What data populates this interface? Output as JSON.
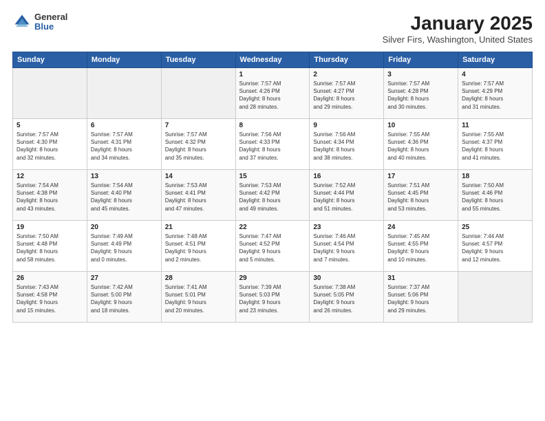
{
  "header": {
    "logo_general": "General",
    "logo_blue": "Blue",
    "title": "January 2025",
    "subtitle": "Silver Firs, Washington, United States"
  },
  "days_of_week": [
    "Sunday",
    "Monday",
    "Tuesday",
    "Wednesday",
    "Thursday",
    "Friday",
    "Saturday"
  ],
  "weeks": [
    [
      {
        "day": "",
        "info": ""
      },
      {
        "day": "",
        "info": ""
      },
      {
        "day": "",
        "info": ""
      },
      {
        "day": "1",
        "info": "Sunrise: 7:57 AM\nSunset: 4:26 PM\nDaylight: 8 hours\nand 28 minutes."
      },
      {
        "day": "2",
        "info": "Sunrise: 7:57 AM\nSunset: 4:27 PM\nDaylight: 8 hours\nand 29 minutes."
      },
      {
        "day": "3",
        "info": "Sunrise: 7:57 AM\nSunset: 4:28 PM\nDaylight: 8 hours\nand 30 minutes."
      },
      {
        "day": "4",
        "info": "Sunrise: 7:57 AM\nSunset: 4:29 PM\nDaylight: 8 hours\nand 31 minutes."
      }
    ],
    [
      {
        "day": "5",
        "info": "Sunrise: 7:57 AM\nSunset: 4:30 PM\nDaylight: 8 hours\nand 32 minutes."
      },
      {
        "day": "6",
        "info": "Sunrise: 7:57 AM\nSunset: 4:31 PM\nDaylight: 8 hours\nand 34 minutes."
      },
      {
        "day": "7",
        "info": "Sunrise: 7:57 AM\nSunset: 4:32 PM\nDaylight: 8 hours\nand 35 minutes."
      },
      {
        "day": "8",
        "info": "Sunrise: 7:56 AM\nSunset: 4:33 PM\nDaylight: 8 hours\nand 37 minutes."
      },
      {
        "day": "9",
        "info": "Sunrise: 7:56 AM\nSunset: 4:34 PM\nDaylight: 8 hours\nand 38 minutes."
      },
      {
        "day": "10",
        "info": "Sunrise: 7:55 AM\nSunset: 4:36 PM\nDaylight: 8 hours\nand 40 minutes."
      },
      {
        "day": "11",
        "info": "Sunrise: 7:55 AM\nSunset: 4:37 PM\nDaylight: 8 hours\nand 41 minutes."
      }
    ],
    [
      {
        "day": "12",
        "info": "Sunrise: 7:54 AM\nSunset: 4:38 PM\nDaylight: 8 hours\nand 43 minutes."
      },
      {
        "day": "13",
        "info": "Sunrise: 7:54 AM\nSunset: 4:40 PM\nDaylight: 8 hours\nand 45 minutes."
      },
      {
        "day": "14",
        "info": "Sunrise: 7:53 AM\nSunset: 4:41 PM\nDaylight: 8 hours\nand 47 minutes."
      },
      {
        "day": "15",
        "info": "Sunrise: 7:53 AM\nSunset: 4:42 PM\nDaylight: 8 hours\nand 49 minutes."
      },
      {
        "day": "16",
        "info": "Sunrise: 7:52 AM\nSunset: 4:44 PM\nDaylight: 8 hours\nand 51 minutes."
      },
      {
        "day": "17",
        "info": "Sunrise: 7:51 AM\nSunset: 4:45 PM\nDaylight: 8 hours\nand 53 minutes."
      },
      {
        "day": "18",
        "info": "Sunrise: 7:50 AM\nSunset: 4:46 PM\nDaylight: 8 hours\nand 55 minutes."
      }
    ],
    [
      {
        "day": "19",
        "info": "Sunrise: 7:50 AM\nSunset: 4:48 PM\nDaylight: 8 hours\nand 58 minutes."
      },
      {
        "day": "20",
        "info": "Sunrise: 7:49 AM\nSunset: 4:49 PM\nDaylight: 9 hours\nand 0 minutes."
      },
      {
        "day": "21",
        "info": "Sunrise: 7:48 AM\nSunset: 4:51 PM\nDaylight: 9 hours\nand 2 minutes."
      },
      {
        "day": "22",
        "info": "Sunrise: 7:47 AM\nSunset: 4:52 PM\nDaylight: 9 hours\nand 5 minutes."
      },
      {
        "day": "23",
        "info": "Sunrise: 7:46 AM\nSunset: 4:54 PM\nDaylight: 9 hours\nand 7 minutes."
      },
      {
        "day": "24",
        "info": "Sunrise: 7:45 AM\nSunset: 4:55 PM\nDaylight: 9 hours\nand 10 minutes."
      },
      {
        "day": "25",
        "info": "Sunrise: 7:44 AM\nSunset: 4:57 PM\nDaylight: 9 hours\nand 12 minutes."
      }
    ],
    [
      {
        "day": "26",
        "info": "Sunrise: 7:43 AM\nSunset: 4:58 PM\nDaylight: 9 hours\nand 15 minutes."
      },
      {
        "day": "27",
        "info": "Sunrise: 7:42 AM\nSunset: 5:00 PM\nDaylight: 9 hours\nand 18 minutes."
      },
      {
        "day": "28",
        "info": "Sunrise: 7:41 AM\nSunset: 5:01 PM\nDaylight: 9 hours\nand 20 minutes."
      },
      {
        "day": "29",
        "info": "Sunrise: 7:39 AM\nSunset: 5:03 PM\nDaylight: 9 hours\nand 23 minutes."
      },
      {
        "day": "30",
        "info": "Sunrise: 7:38 AM\nSunset: 5:05 PM\nDaylight: 9 hours\nand 26 minutes."
      },
      {
        "day": "31",
        "info": "Sunrise: 7:37 AM\nSunset: 5:06 PM\nDaylight: 9 hours\nand 29 minutes."
      },
      {
        "day": "",
        "info": ""
      }
    ]
  ]
}
